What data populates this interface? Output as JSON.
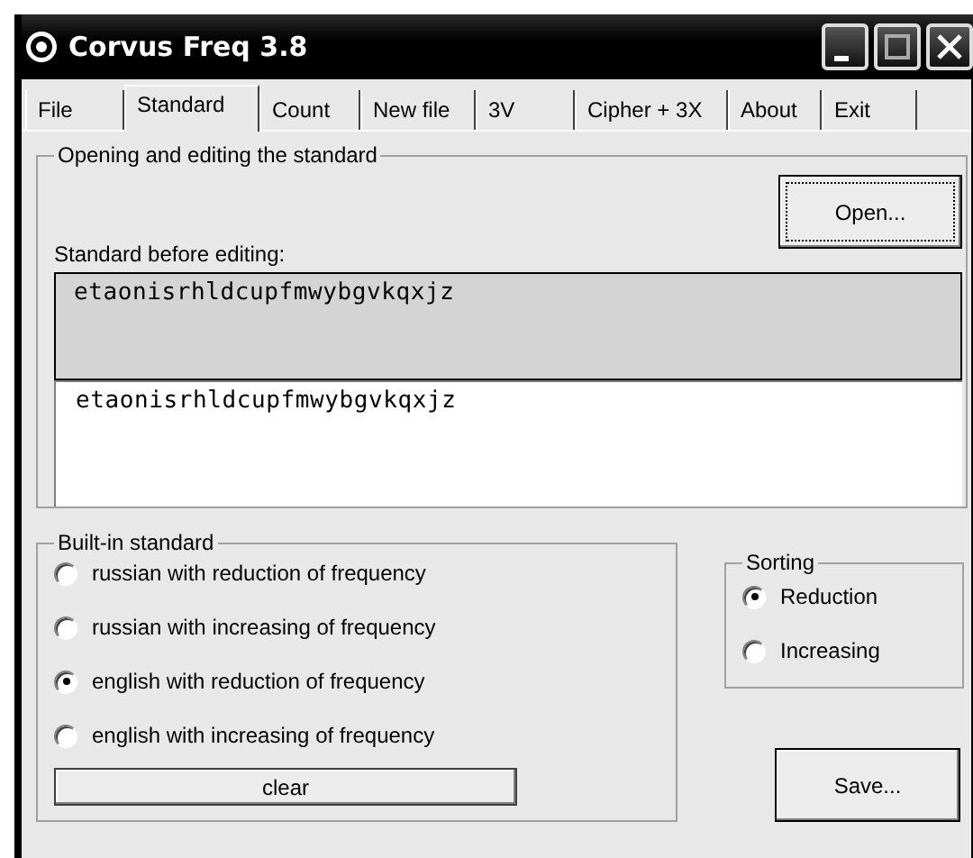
{
  "window": {
    "title": "Corvus Freq 3.8"
  },
  "tabs": [
    {
      "label": "File",
      "selected": false
    },
    {
      "label": "Standard",
      "selected": true
    },
    {
      "label": "Count",
      "selected": false
    },
    {
      "label": "New file",
      "selected": false
    },
    {
      "label": "3V",
      "selected": false
    },
    {
      "label": "Cipher + 3X",
      "selected": false
    },
    {
      "label": "About",
      "selected": false
    },
    {
      "label": "Exit",
      "selected": false
    }
  ],
  "opening_group": {
    "title": "Opening and editing the standard",
    "open_button": "Open...",
    "before_label": "Standard before editing:",
    "before_text": "etaonisrhldcupfmwybgvkqxjz",
    "edit_text": "etaonisrhldcupfmwybgvkqxjz"
  },
  "builtin_group": {
    "title": "Built-in standard",
    "options": [
      {
        "label": "russian with reduction of frequency",
        "selected": false
      },
      {
        "label": "russian with increasing of frequency",
        "selected": false
      },
      {
        "label": "english with reduction of frequency",
        "selected": true
      },
      {
        "label": "english with increasing of frequency",
        "selected": false
      }
    ],
    "clear_button": "clear"
  },
  "sorting_group": {
    "title": "Sorting",
    "options": [
      {
        "label": "Reduction",
        "selected": true
      },
      {
        "label": "Increasing",
        "selected": false
      }
    ]
  },
  "save_button": "Save..."
}
